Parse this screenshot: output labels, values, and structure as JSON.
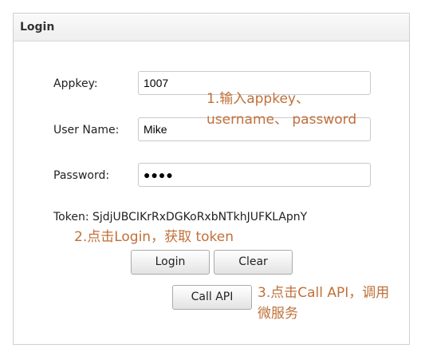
{
  "panel": {
    "title": "Login"
  },
  "form": {
    "appkey": {
      "label": "Appkey:",
      "value": "1007"
    },
    "username": {
      "label": "User Name:",
      "value": "Mike"
    },
    "password": {
      "label": "Password:",
      "masked_value": "●●●●"
    }
  },
  "token": {
    "text": "Token: SjdjUBCIKrRxDGKoRxbNTkhJUFKLApnY"
  },
  "buttons": {
    "login": "Login",
    "clear": "Clear",
    "call_api": "Call API"
  },
  "annotations": {
    "step1_line1": "1.输入appkey、",
    "step1_line2": "username、 password",
    "step2": "2.点击Login，获取 token",
    "step3_line1": "3.点击Call API，调用",
    "step3_line2": "微服务"
  },
  "colors": {
    "annotation": "#c0703a",
    "border": "#cfcfcf"
  }
}
